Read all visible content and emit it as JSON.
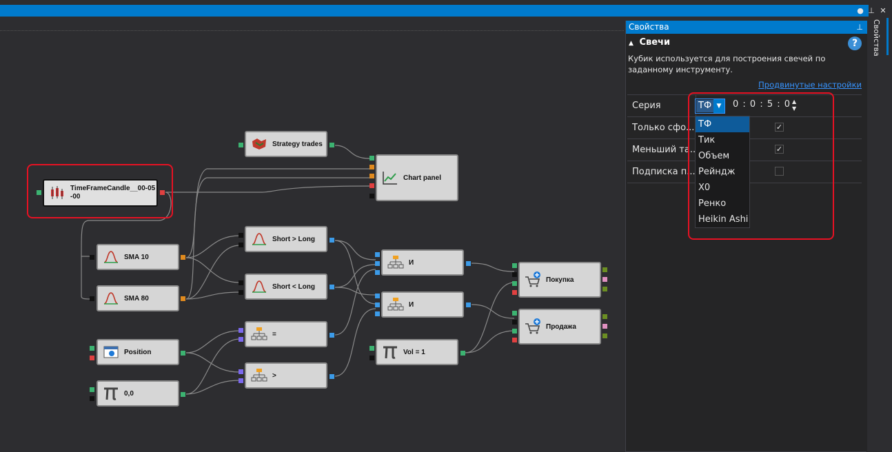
{
  "properties_panel": {
    "title": "Свойства",
    "section_title": "Свечи",
    "description": "Кубик используется для построения свечей по заданному инструменту.",
    "advanced_link": "Продвинутые настройки",
    "rows": [
      {
        "label": "Серия"
      },
      {
        "label": "Только сфо...",
        "checked": true
      },
      {
        "label": "Меньший та...",
        "checked": true
      },
      {
        "label": "Подписка п...",
        "checked": false
      }
    ],
    "series_combo_value": "ТФ",
    "timeframe_value": "0 : 0 : 5 : 0",
    "dropdown_options": [
      "ТФ",
      "Тик",
      "Объем",
      "Рейндж",
      "X0",
      "Ренко",
      "Heikin Ashi"
    ],
    "dropdown_selected": "ТФ"
  },
  "side_tab_label": "Свойства",
  "nodes": {
    "strategy_trades": "Strategy trades",
    "chart_panel": "Chart panel",
    "timeframe_candle": "TimeFrameCandle__00-05-00",
    "sma10": "SMA 10",
    "sma80": "SMA 80",
    "short_gt_long": "Short > Long",
    "short_lt_long": "Short < Long",
    "and1": "И",
    "and2": "И",
    "buy": "Покупка",
    "sell": "Продажа",
    "equals": "=",
    "greater": ">",
    "position": "Position",
    "zero": "0,0",
    "vol": "Vol = 1"
  },
  "colors": {
    "accent": "#007acc",
    "highlight": "#e81123",
    "port_green": "#3cb371",
    "port_orange": "#e08a1e",
    "port_blue": "#3c9be8",
    "port_red": "#e04040",
    "port_purple": "#7b68ee"
  }
}
